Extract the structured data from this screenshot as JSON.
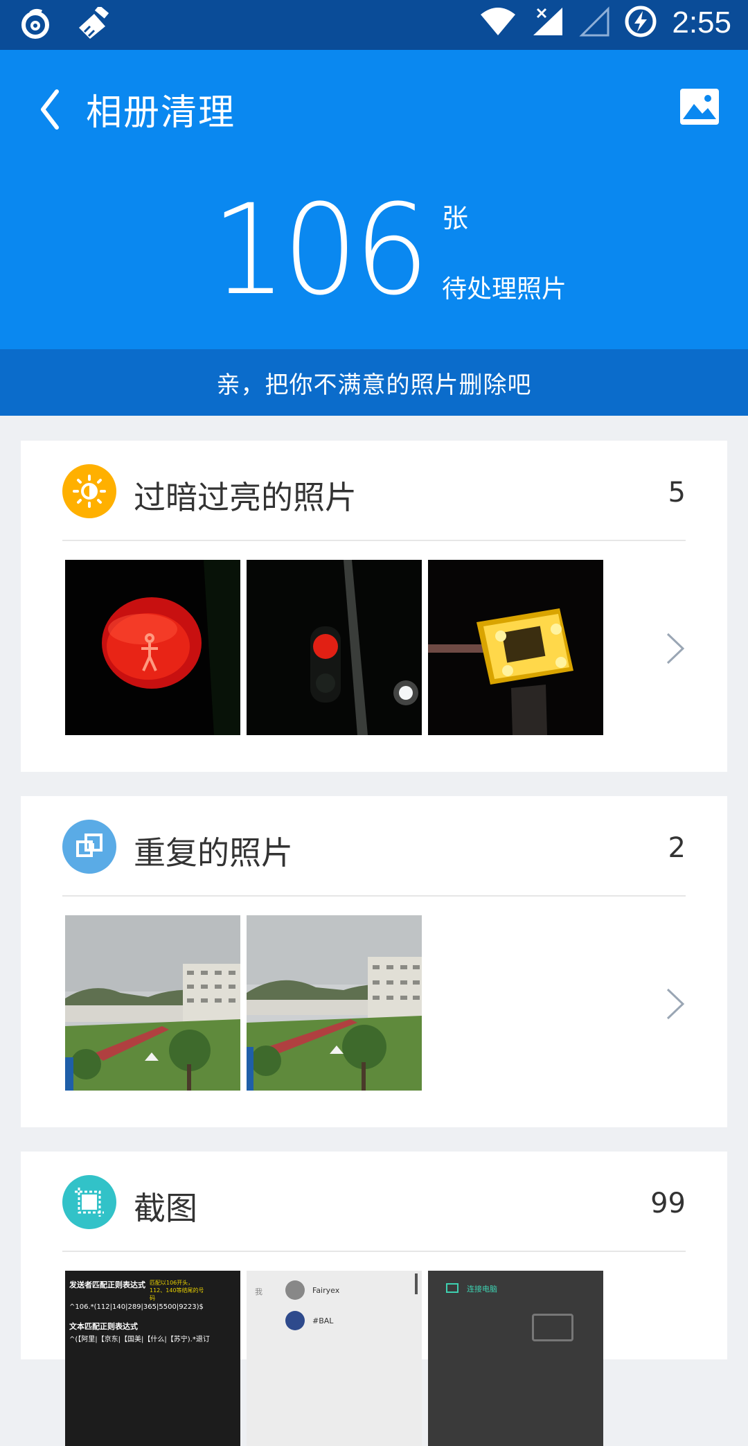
{
  "status_bar": {
    "time": "2:55"
  },
  "header": {
    "title": "相册清理",
    "count": "106",
    "unit": "张",
    "count_label": "待处理照片"
  },
  "banner": {
    "text": "亲，把你不满意的照片删除吧"
  },
  "sections": [
    {
      "title": "过暗过亮的照片",
      "count": "5",
      "icon": "brightness-icon",
      "color": "#ffb000"
    },
    {
      "title": "重复的照片",
      "count": "2",
      "icon": "duplicate-icon",
      "color": "#5aabe6"
    },
    {
      "title": "截图",
      "count": "99",
      "icon": "crop-icon",
      "color": "#32c2c8"
    }
  ],
  "screenshot_thumbs": {
    "thumb1_line1": "发送者匹配正则表达式",
    "thumb1_line2": "^106.*(112|140|289|365|5500|9223)$",
    "thumb1_line3": "文本匹配正则表达式",
    "thumb1_line4": "^(【阿里|【京东|【国美|【什么|【苏宁).*退订",
    "thumb1_side": "匹配以106开头，112、140等结尾的号码",
    "thumb2_item1": "Fairyex",
    "thumb2_item2": "#BAL",
    "thumb2_me": "我",
    "thumb3_label": "连接电脑"
  }
}
